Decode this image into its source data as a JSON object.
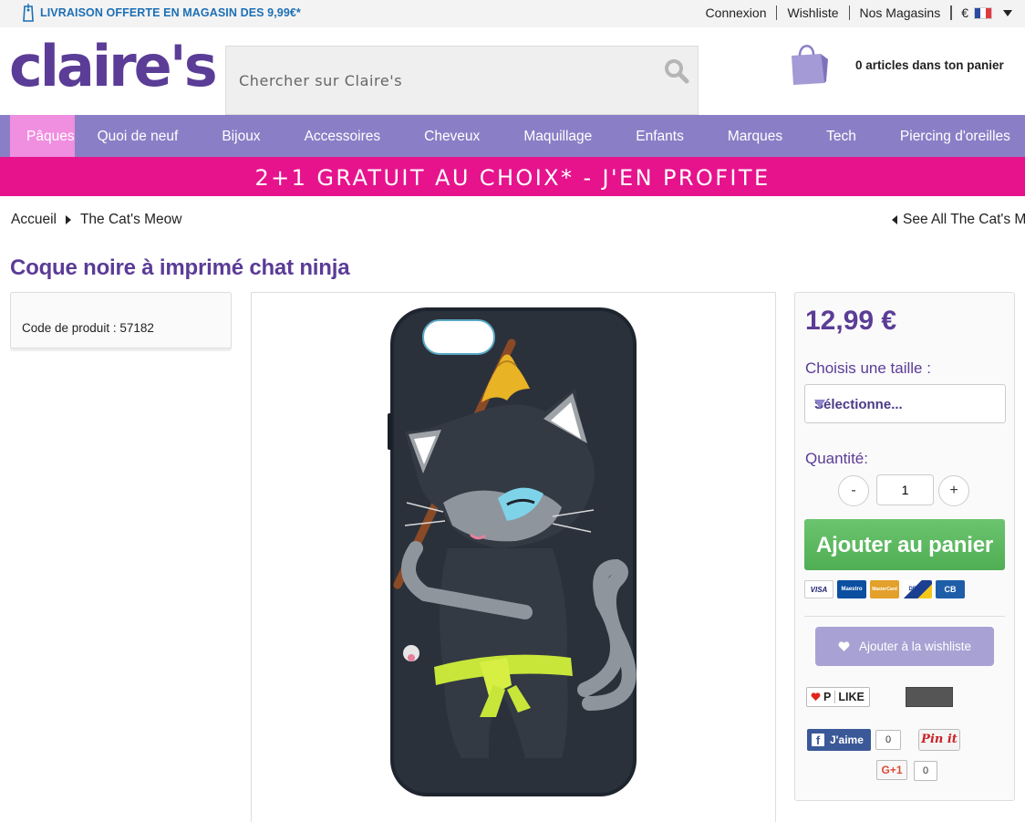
{
  "topbar": {
    "promo": "LIVRAISON OFFERTE EN MAGASIN DES 9,99€*",
    "links": [
      "Connexion",
      "Wishliste",
      "Nos Magasins"
    ],
    "currency": "€",
    "flag": "fr-flag-icon"
  },
  "header": {
    "logo": "claire's",
    "search_placeholder": "Chercher sur Claire's",
    "cart_text": "0 articles dans ton panier"
  },
  "nav": {
    "items": [
      "Pâques",
      "Quoi de neuf",
      "Bijoux",
      "Accessoires",
      "Cheveux",
      "Maquillage",
      "Enfants",
      "Marques",
      "Tech",
      "Piercing d'oreilles"
    ],
    "active_index": 0
  },
  "banner": "2+1 GRATUIT AU CHOIX* - J'EN PROFITE",
  "breadcrumb": {
    "items": [
      "Accueil",
      "The Cat's Meow"
    ],
    "see_all": "See All The Cat's M"
  },
  "product": {
    "title": "Coque noire à imprimé chat ninja",
    "code": "Code de produit : 57182",
    "price": "12,99 €",
    "size_label": "Choisis une taille :",
    "size_selected": "Sélectionne...",
    "qty_label": "Quantité:",
    "qty_value": "1",
    "qty_minus": "-",
    "qty_plus": "+",
    "add_to_cart": "Ajouter au panier",
    "add_to_wishlist": "Ajouter à la wishliste"
  },
  "payment_cards": [
    {
      "label": "VISA",
      "color": "#ffffff",
      "text_color": "#1a1f71"
    },
    {
      "label": "Maestro",
      "color": "#0a4fa0",
      "text_color": "#ffffff"
    },
    {
      "label": "MasterCard",
      "color": "#e3a02a",
      "text_color": "#ffffff"
    },
    {
      "label": "DELTA",
      "color": "#1b3f91",
      "text_color": "#ffffff"
    },
    {
      "label": "CB",
      "color": "#1e5ea8",
      "text_color": "#ffffff"
    }
  ],
  "social": {
    "plike": "LIKE",
    "plike_prefix": "P",
    "fb_label": "J'aime",
    "fb_count": "0",
    "pin_label": "Pin it",
    "gplus_label": "G+1",
    "gplus_count": "0"
  },
  "colors": {
    "brand_purple": "#5b3c96",
    "nav_purple": "#8a7fc6",
    "nav_active": "#f08ee0",
    "banner_pink": "#e6138d",
    "cart_green": "#5cb85c"
  }
}
